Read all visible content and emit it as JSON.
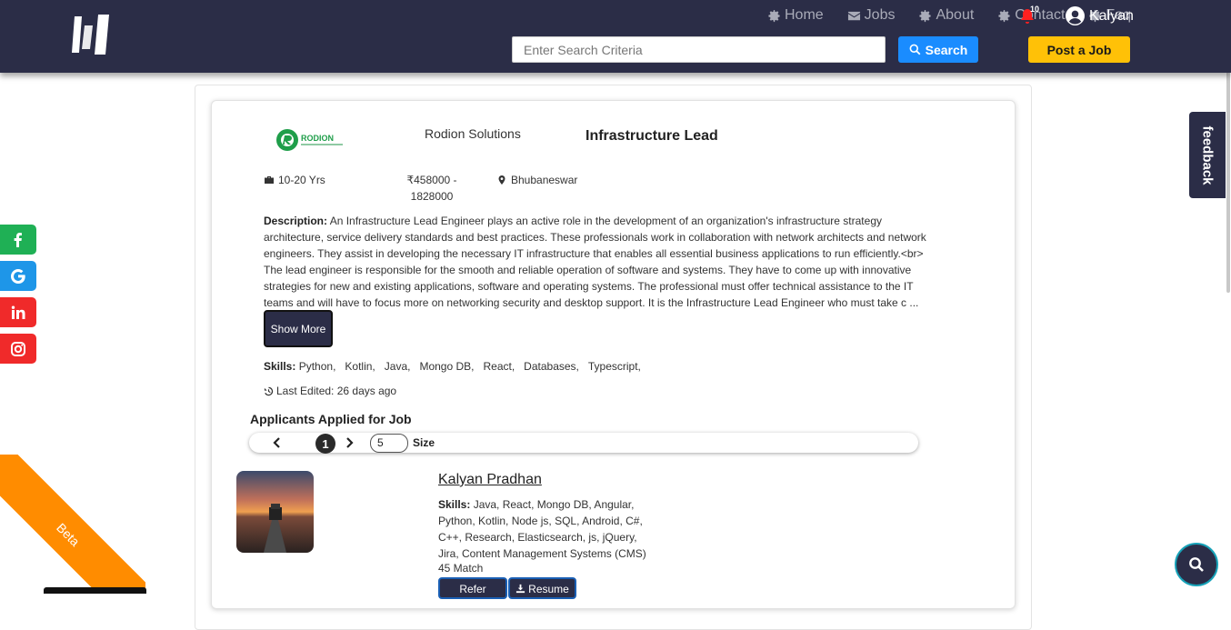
{
  "nav": {
    "home": "Home",
    "jobs": "Jobs",
    "about": "About",
    "contact": "Contact",
    "faq": "Faq",
    "notification_count": "10",
    "user_name": "Kalyan"
  },
  "search": {
    "placeholder": "Enter Search Criteria",
    "button_label": "Search"
  },
  "post_job_label": "Post a Job",
  "job": {
    "company_logo_text": "RODION",
    "company_name": "Rodion Solutions",
    "title": "Infrastructure Lead",
    "experience": "10-20 Yrs",
    "salary": "₹458000 - 1828000",
    "location": "Bhubaneswar",
    "description_label": "Description:",
    "description": "An Infrastructure Lead Engineer plays an active role in the development of an organization's infrastructure strategy architecture, service delivery standards and best practices. These professionals work in collaboration with network architects and network engineers. They assist in developing the necessary IT infrastructure that enables all essential business applications to run efficiently.<br> The lead engineer is responsible for the smooth and reliable operation of software and systems. They have to come up with innovative strategies for new and existing applications, software and operating systems. The professional must offer technical assistance to the IT teams and will have to focus more on networking security and desktop support. It is the Infrastructure Lead Engineer who must take c ...",
    "show_more_label": "Show More",
    "skills_label": "Skills:",
    "skills": [
      "Python,",
      "Kotlin,",
      "Java,",
      "Mongo DB,",
      "React,",
      "Databases,",
      "Typescript,"
    ],
    "last_edited": "Last Edited: 26 days ago"
  },
  "applicants": {
    "title": "Applicants Applied for Job",
    "current_page": "1",
    "size_value": "5",
    "size_label": "Size",
    "items": [
      {
        "name": "Kalyan Pradhan",
        "skills_label": "Skills:",
        "skills": "Java, React, Mongo DB, Angular, Python, Kotlin, Node js, SQL, Android, C#, C++, Research, Elasticsearch, js, jQuery, Jira, Content Management Systems (CMS)",
        "match": "45 Match",
        "refer_label": "Refer",
        "resume_label": "Resume"
      }
    ]
  },
  "feedback_label": "feedback",
  "beta_label": "Beta",
  "social": [
    "facebook-icon",
    "google-icon",
    "linkedin-icon",
    "instagram-icon"
  ],
  "colors": {
    "header": "#2b2d47",
    "search_button": "#1a8cff",
    "post_button": "#ffc107",
    "beta_ribbon": "#ff8c00",
    "facebook": "#1fb055",
    "google": "#1e96e8",
    "linkedin": "#f02a2a",
    "instagram": "#f02a2a"
  }
}
